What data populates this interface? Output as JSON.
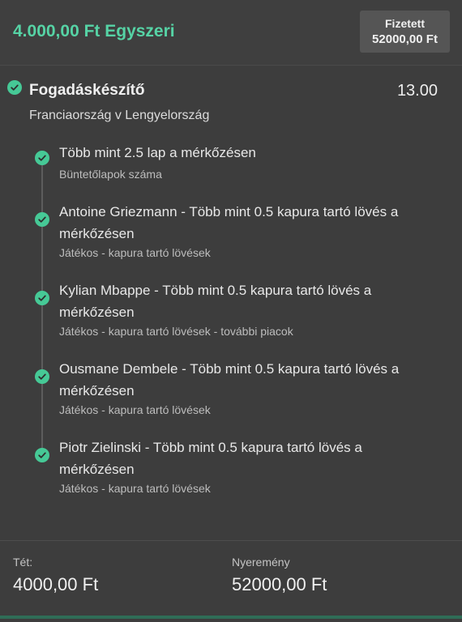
{
  "header": {
    "bet_title": "4.000,00 Ft Egyszeri",
    "status_label": "Fizetett",
    "status_amount": "52000,00 Ft"
  },
  "bet_builder": {
    "title": "Fogadáskészítő",
    "odds": "13.00",
    "match": "Franciaország v Lengyelország",
    "selections": [
      {
        "title": "Több mint 2.5 lap a mérkőzésen",
        "subtitle": "Büntetőlapok száma"
      },
      {
        "title": "Antoine Griezmann - Több mint 0.5 kapura tartó lövés a mérkőzésen",
        "subtitle": "Játékos - kapura tartó lövések"
      },
      {
        "title": "Kylian Mbappe - Több mint 0.5 kapura tartó lövés a mérkőzésen",
        "subtitle": "Játékos - kapura tartó lövések - további piacok"
      },
      {
        "title": "Ousmane Dembele - Több mint 0.5 kapura tartó lövés a mérkőzésen",
        "subtitle": "Játékos - kapura tartó lövések"
      },
      {
        "title": "Piotr Zielinski - Több mint 0.5 kapura tartó lövés a mérkőzésen",
        "subtitle": "Játékos - kapura tartó lövések"
      }
    ]
  },
  "footer": {
    "stake_label": "Tét:",
    "stake_value": "4000,00 Ft",
    "winnings_label": "Nyeremény",
    "winnings_value": "52000,00 Ft"
  },
  "colors": {
    "accent": "#56d3a5",
    "check": "#46c996",
    "background": "#3d3d3d"
  }
}
